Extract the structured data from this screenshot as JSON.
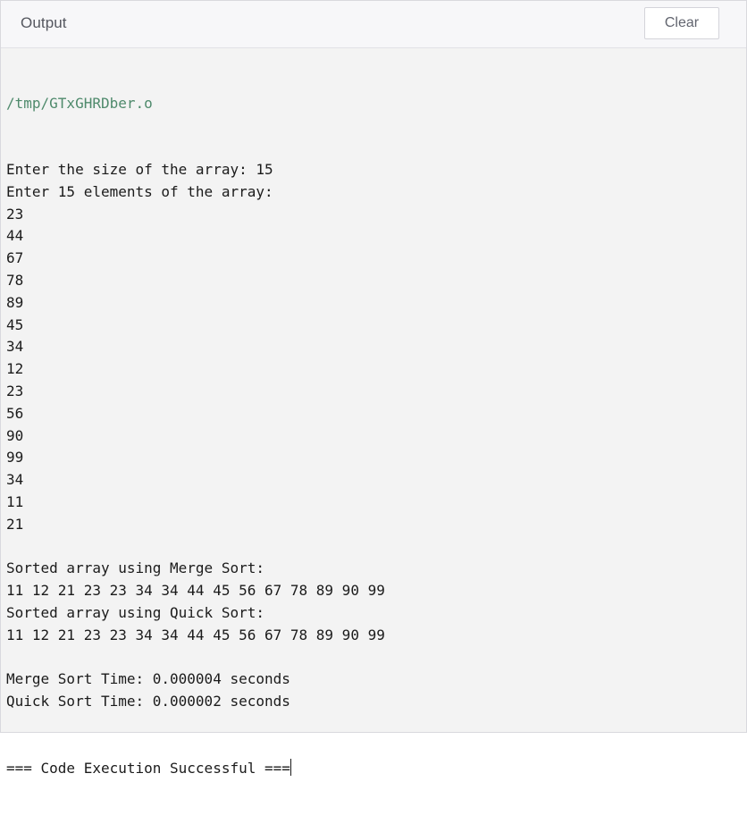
{
  "header": {
    "title": "Output",
    "clear_label": "Clear"
  },
  "console": {
    "path": "/tmp/GTxGHRDber.o",
    "lines": [
      "Enter the size of the array: 15",
      "Enter 15 elements of the array:",
      "23",
      "44",
      "67",
      "78",
      "89",
      "45",
      "34",
      "12",
      "23",
      "56",
      "90",
      "99",
      "34",
      "11",
      "21",
      "",
      "Sorted array using Merge Sort:",
      "11 12 21 23 23 34 34 44 45 56 67 78 89 90 99",
      "Sorted array using Quick Sort:",
      "11 12 21 23 23 34 34 44 45 56 67 78 89 90 99",
      "",
      "Merge Sort Time: 0.000004 seconds",
      "Quick Sort Time: 0.000002 seconds",
      "",
      "",
      "=== Code Execution Successful ==="
    ]
  },
  "colors": {
    "path_text": "#4f8a6c",
    "console_text": "#1b1b1b",
    "console_bg": "#f3f3f3"
  }
}
